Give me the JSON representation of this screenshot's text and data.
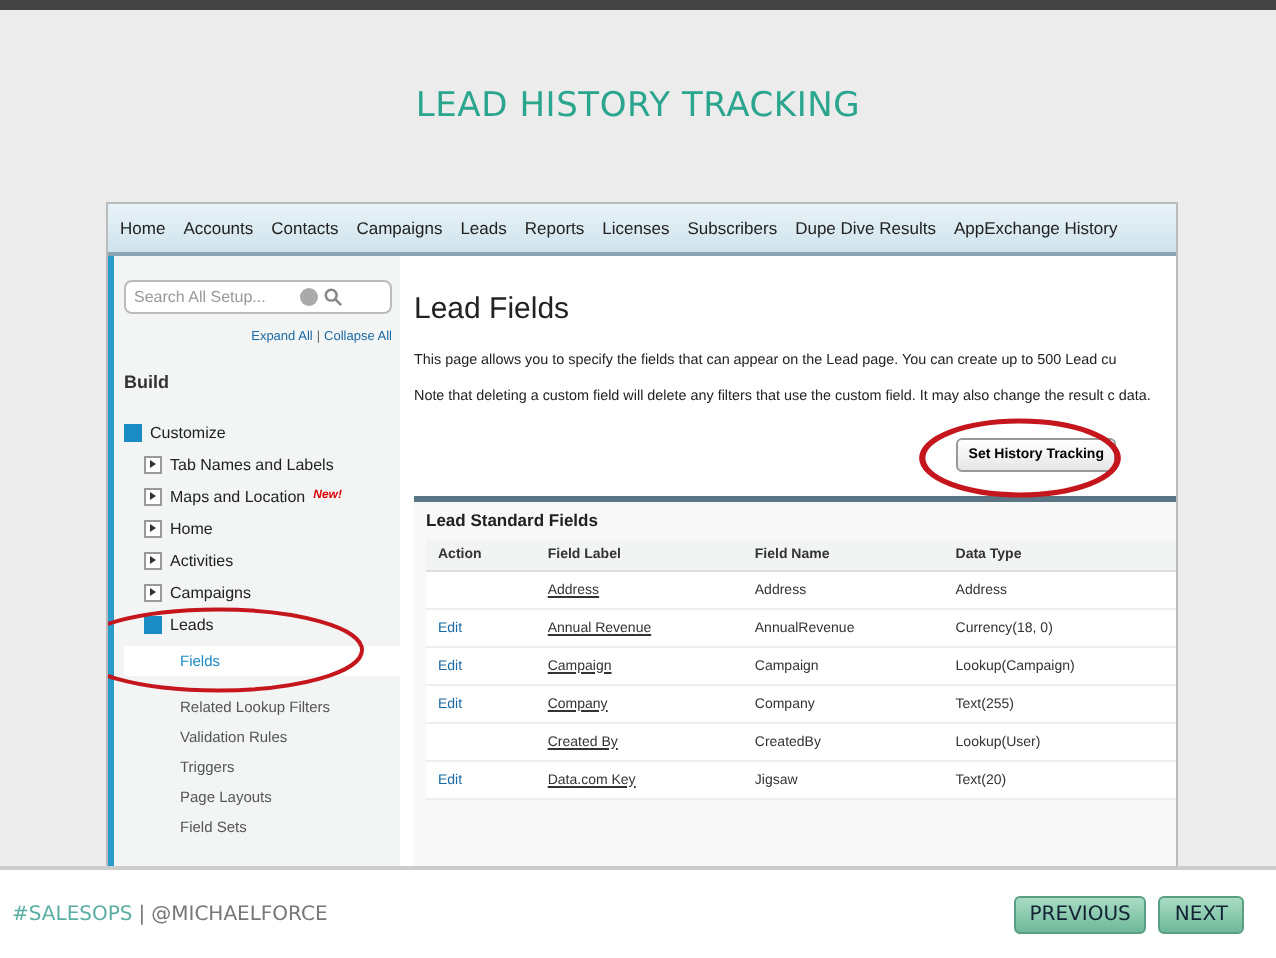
{
  "slide_title": "LEAD HISTORY TRACKING",
  "nav_tabs": [
    "Home",
    "Accounts",
    "Contacts",
    "Campaigns",
    "Leads",
    "Reports",
    "Licenses",
    "Subscribers",
    "Dupe Dive Results",
    "AppExchange History"
  ],
  "sidebar": {
    "search": {
      "placeholder": "Search All Setup..."
    },
    "expand_all": "Expand All",
    "separator": "|",
    "collapse_all": "Collapse All",
    "section": "Build",
    "items": [
      {
        "label": "Customize",
        "expanded": true,
        "children": [
          {
            "label": "Tab Names and Labels",
            "expanded": false
          },
          {
            "label": "Maps and Location",
            "expanded": false,
            "badge": "New!"
          },
          {
            "label": "Home",
            "expanded": false
          },
          {
            "label": "Activities",
            "expanded": false
          },
          {
            "label": "Campaigns",
            "expanded": false
          },
          {
            "label": "Leads",
            "expanded": true,
            "children": [
              {
                "label": "Fields",
                "selected": true
              },
              {
                "label": "Related Lookup Filters",
                "selected": false
              },
              {
                "label": "Validation Rules",
                "selected": false
              },
              {
                "label": "Triggers",
                "selected": false
              },
              {
                "label": "Page Layouts",
                "selected": false
              },
              {
                "label": "Field Sets",
                "selected": false
              }
            ]
          }
        ]
      }
    ]
  },
  "main": {
    "title": "Lead Fields",
    "paragraphs": [
      "This page allows you to specify the fields that can appear on the Lead page. You can create up to 500 Lead cu",
      "Note that deleting a custom field will delete any filters that use the custom field. It may also change the result c data."
    ],
    "button": "Set History Tracking",
    "table": {
      "title": "Lead Standard Fields",
      "columns": [
        "Action",
        "Field Label",
        "Field Name",
        "Data Type"
      ],
      "rows": [
        {
          "action": "",
          "label": "Address",
          "name": "Address",
          "type": "Address"
        },
        {
          "action": "Edit",
          "label": "Annual Revenue",
          "name": "AnnualRevenue",
          "type": "Currency(18, 0)"
        },
        {
          "action": "Edit",
          "label": "Campaign",
          "name": "Campaign",
          "type": "Lookup(Campaign)"
        },
        {
          "action": "Edit",
          "label": "Company",
          "name": "Company",
          "type": "Text(255)"
        },
        {
          "action": "",
          "label": "Created By",
          "name": "CreatedBy",
          "type": "Lookup(User)"
        },
        {
          "action": "Edit",
          "label": "Data.com Key",
          "name": "Jigsaw",
          "type": "Text(20)"
        }
      ]
    }
  },
  "footer": {
    "hashtag": "#SALESOPS",
    "separator": "|",
    "handle": "@MICHAELFORCE",
    "buttons": [
      "PREVIOUS",
      "NEXT"
    ]
  }
}
